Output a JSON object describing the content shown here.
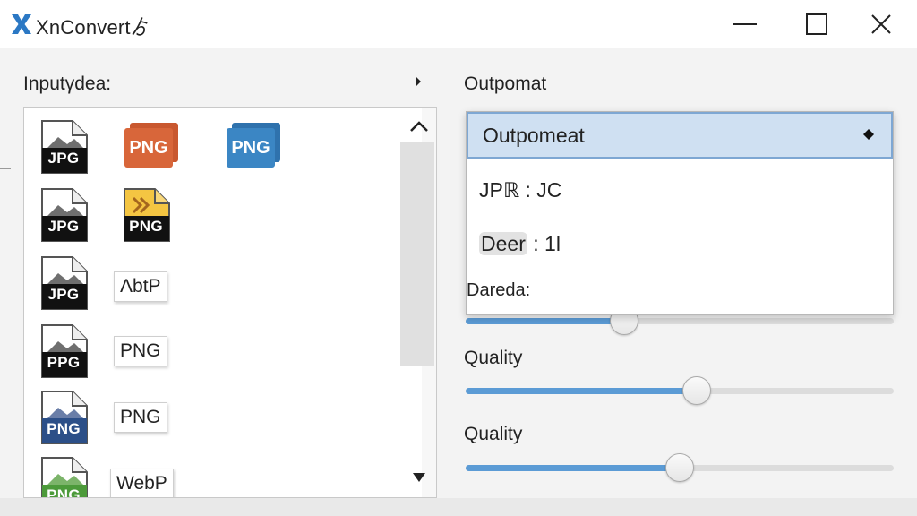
{
  "window": {
    "title": "XnConvert",
    "title_suffix": "ゟ"
  },
  "input_panel": {
    "label": "Inputγdea:",
    "files": [
      {
        "type": "doc",
        "label": "JPG",
        "color": "#111111"
      },
      {
        "type": "stack",
        "label": "PNG",
        "color": "#d8663a"
      },
      {
        "type": "stack",
        "label": "PNG",
        "color": "#3b86c4"
      },
      {
        "type": "doc",
        "label": "JPG",
        "color": "#111111"
      },
      {
        "type": "doc-yellow",
        "label": "PNG",
        "color": "#111111"
      },
      {
        "type": "doc",
        "label": "JPG",
        "color": "#111111"
      },
      {
        "type": "chip",
        "label": "ΛbtP"
      },
      {
        "type": "doc",
        "label": "PPG",
        "color": "#111111"
      },
      {
        "type": "chip",
        "label": "PNG"
      },
      {
        "type": "doc",
        "label": "PNG",
        "color": "#2c4f88"
      },
      {
        "type": "chip",
        "label": "PNG"
      },
      {
        "type": "doc",
        "label": "PNG",
        "color": "#4c9a3a"
      },
      {
        "type": "chip",
        "label": "WebP"
      }
    ]
  },
  "output_panel": {
    "label": "Outpomat",
    "dropdown": {
      "selected": "Outpomeat",
      "options": [
        {
          "label": "JPℝ : JC"
        },
        {
          "label": "Deer : 1l",
          "highlight_part": "Deer"
        }
      ],
      "trailing_label": "Dareda:"
    },
    "sliders": [
      {
        "label": "",
        "value": 0.37
      },
      {
        "label": "Quality",
        "value": 0.54
      },
      {
        "label": "Quality",
        "value": 0.5
      }
    ]
  },
  "colors": {
    "accent": "#5b9bd5",
    "dropdown_highlight": "#cfe0f2",
    "logo": "#2b78c4"
  },
  "icons": {
    "logo": "xnconvert-logo-icon",
    "minimize": "minimize-icon",
    "maximize": "maximize-icon",
    "close": "close-icon",
    "expand_arrow": "triangle-right-icon",
    "scroll_up": "chevron-up-icon",
    "scroll_down": "chevron-down-icon",
    "dropdown_caret": "diamond-caret-icon"
  }
}
